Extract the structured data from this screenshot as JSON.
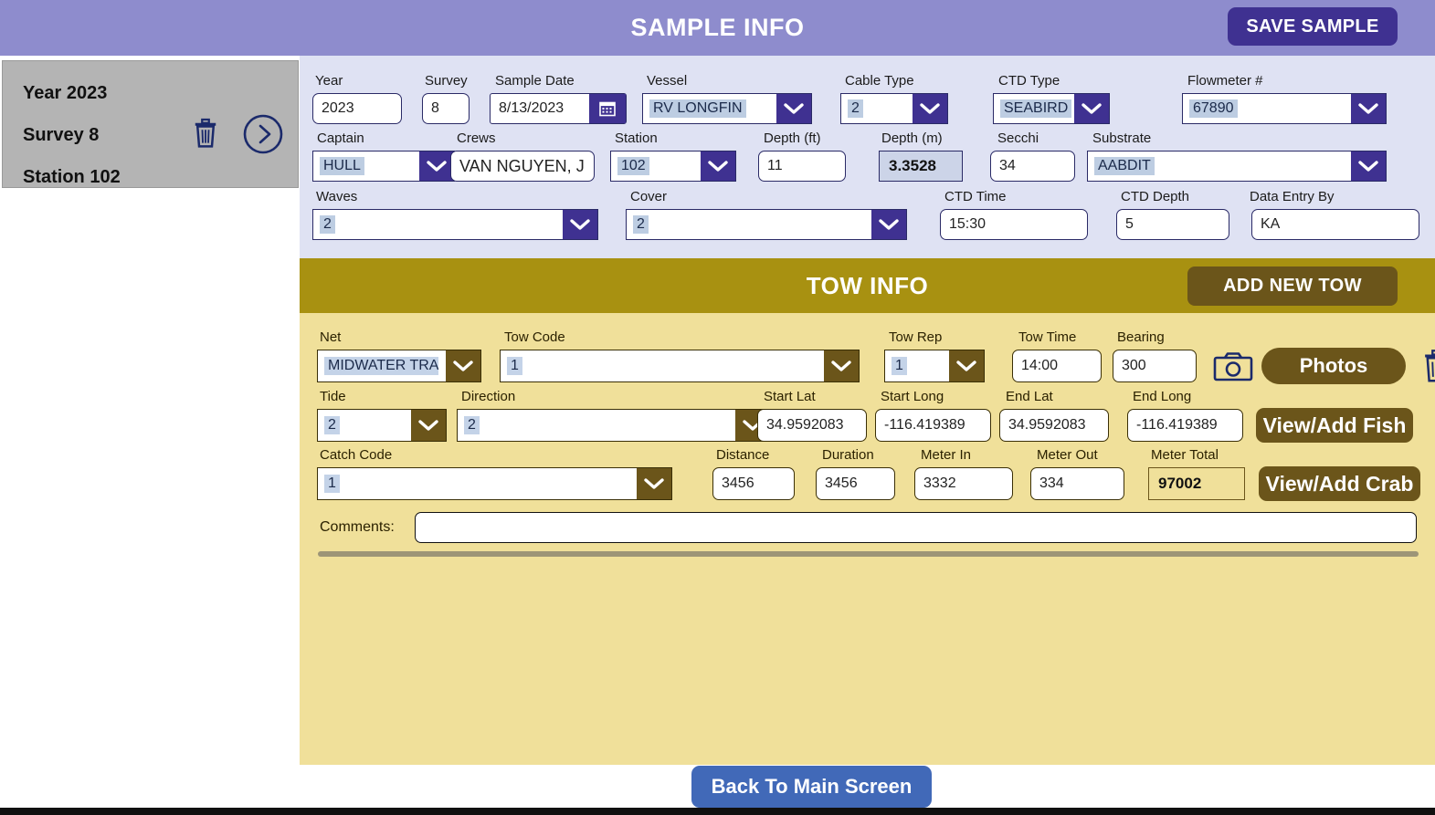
{
  "header": {
    "title": "SAMPLE INFO",
    "save_label": "SAVE SAMPLE"
  },
  "sidebar": {
    "card": {
      "year": "Year 2023",
      "survey": "Survey 8",
      "station": "Station 102",
      "delete_icon": "trash-icon",
      "open_icon": "chevron-right-circle-icon"
    }
  },
  "sample_info": {
    "fields": {
      "year": {
        "label": "Year",
        "value": "2023"
      },
      "survey": {
        "label": "Survey",
        "value": "8"
      },
      "sample_date": {
        "label": "Sample Date",
        "value": "8/13/2023",
        "icon": "calendar-icon"
      },
      "vessel": {
        "label": "Vessel",
        "value": "RV LONGFIN"
      },
      "cable_type": {
        "label": "Cable Type",
        "value": "2"
      },
      "ctd_type": {
        "label": "CTD Type",
        "value": "SEABIRD"
      },
      "flowmeter": {
        "label": "Flowmeter #",
        "value": "67890"
      },
      "captain": {
        "label": "Captain",
        "value": "HULL"
      },
      "crews": {
        "label": "Crews",
        "value": "VAN NGUYEN, J"
      },
      "station": {
        "label": "Station",
        "value": "102"
      },
      "depth_ft": {
        "label": "Depth (ft)",
        "value": "11"
      },
      "depth_m": {
        "label": "Depth (m)",
        "value": "3.3528"
      },
      "secchi": {
        "label": "Secchi",
        "value": "34"
      },
      "substrate": {
        "label": "Substrate",
        "value": "AABDIT"
      },
      "waves": {
        "label": "Waves",
        "value": "2"
      },
      "cover": {
        "label": "Cover",
        "value": "2"
      },
      "ctd_time": {
        "label": "CTD Time",
        "value": "15:30"
      },
      "ctd_depth": {
        "label": "CTD Depth",
        "value": "5"
      },
      "data_entry_by": {
        "label": "Data Entry By",
        "value": "KA"
      }
    }
  },
  "tow_info": {
    "title": "TOW INFO",
    "add_new_tow_label": "ADD NEW TOW",
    "fields": {
      "net": {
        "label": "Net",
        "value": "MIDWATER TRAWL"
      },
      "tow_code": {
        "label": "Tow Code",
        "value": "1"
      },
      "tow_rep": {
        "label": "Tow Rep",
        "value": "1"
      },
      "tow_time": {
        "label": "Tow Time",
        "value": "14:00"
      },
      "bearing": {
        "label": "Bearing",
        "value": "300"
      },
      "tide": {
        "label": "Tide",
        "value": "2"
      },
      "direction": {
        "label": "Direction",
        "value": "2"
      },
      "start_lat": {
        "label": "Start Lat",
        "value": "34.9592083"
      },
      "start_long": {
        "label": "Start Long",
        "value": "-116.419389"
      },
      "end_lat": {
        "label": "End Lat",
        "value": "34.9592083"
      },
      "end_long": {
        "label": "End Long",
        "value": "-116.419389"
      },
      "catch_code": {
        "label": "Catch Code",
        "value": "1"
      },
      "distance": {
        "label": "Distance",
        "value": "3456"
      },
      "duration": {
        "label": "Duration",
        "value": "3456"
      },
      "meter_in": {
        "label": "Meter In",
        "value": "3332"
      },
      "meter_out": {
        "label": "Meter Out",
        "value": "334"
      },
      "meter_total": {
        "label": "Meter Total",
        "value": "97002"
      },
      "comments": {
        "label": "Comments:",
        "value": ""
      }
    },
    "buttons": {
      "camera_icon": "camera-icon",
      "photos": "Photos",
      "delete_icon": "trash-icon",
      "view_add_fish": "View/Add Fish",
      "view_add_crab": "View/Add Crab"
    }
  },
  "footer": {
    "back_label": "Back To Main Screen"
  }
}
